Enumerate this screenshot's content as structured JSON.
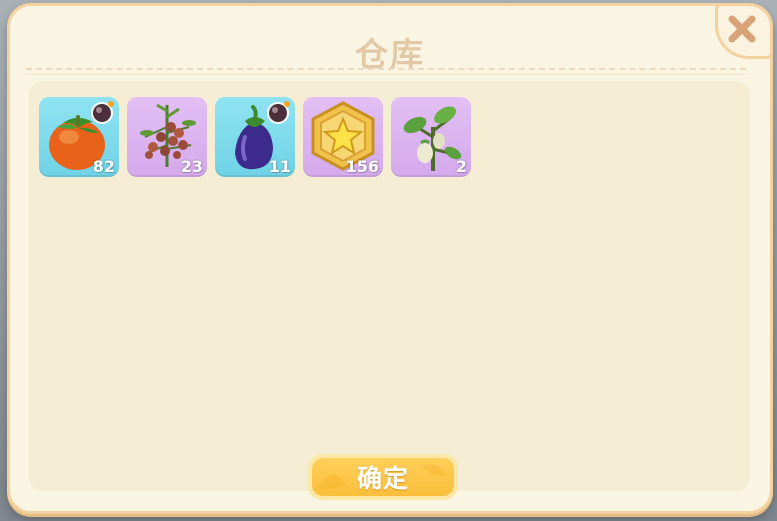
{
  "dialog": {
    "title": "仓库",
    "confirm_label": "确定"
  },
  "inventory": {
    "items": [
      {
        "icon": "tomato-icon",
        "count": "82",
        "has_badge": true,
        "bg": "sky"
      },
      {
        "icon": "tomato-vine-icon",
        "count": "23",
        "has_badge": false,
        "bg": "lilac"
      },
      {
        "icon": "eggplant-icon",
        "count": "11",
        "has_badge": true,
        "bg": "sky"
      },
      {
        "icon": "star-coin-icon",
        "count": "156",
        "has_badge": false,
        "bg": "lilac"
      },
      {
        "icon": "eggplant-sprout-icon",
        "count": "2",
        "has_badge": false,
        "bg": "lilac"
      }
    ]
  },
  "colors": {
    "panel_bg": "#faf4e2",
    "panel_border": "#f3d2a0",
    "content_bg": "#f4edd3",
    "title_text": "#e2c8a5",
    "close_icon": "#d9a37a",
    "slot_sky": "#7fd9ea",
    "slot_lilac": "#dcb6f0",
    "confirm_button": "#ffcf5a"
  }
}
